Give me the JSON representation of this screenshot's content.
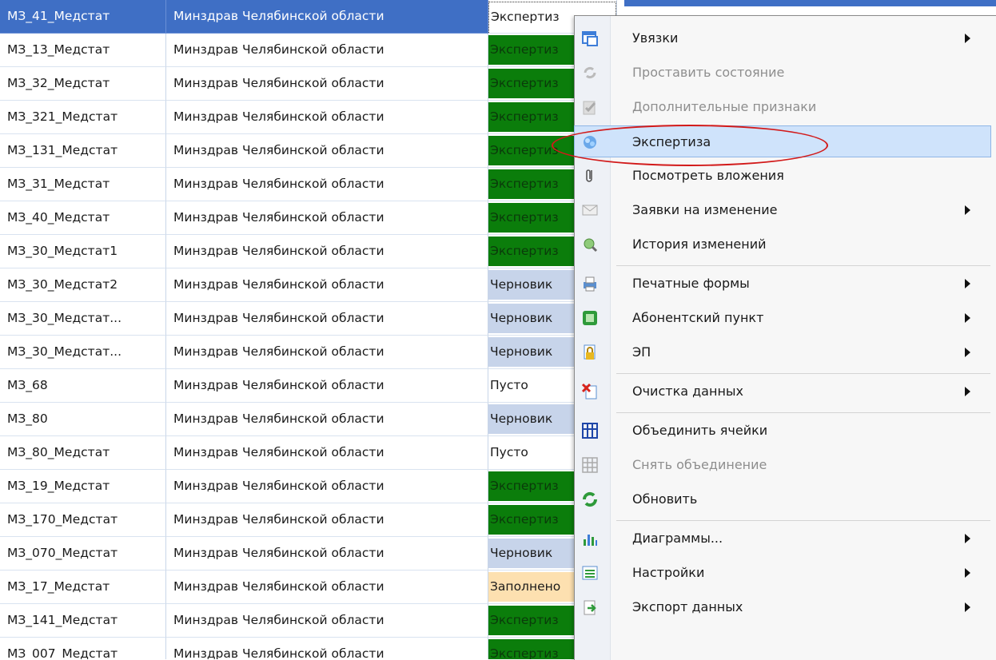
{
  "colors": {
    "selection": "#3f6fc5",
    "status_expertise": "#0b7d0b",
    "status_draft": "#c7d4ea",
    "status_filled": "#fde0b0",
    "menu_highlight": "#cfe3fb",
    "annotation_ring": "#d21a1a"
  },
  "table": {
    "rows": [
      {
        "code": "МЗ_41_Медстат",
        "org": "Минздрав Челябинской области",
        "status": "Экспертиз",
        "status_kind": "focus"
      },
      {
        "code": "МЗ_13_Медстат",
        "org": "Минздрав Челябинской области",
        "status": "Экспертиз",
        "status_kind": "expert"
      },
      {
        "code": "МЗ_32_Медстат",
        "org": "Минздрав Челябинской области",
        "status": "Экспертиз",
        "status_kind": "expert"
      },
      {
        "code": "МЗ_321_Медстат",
        "org": "Минздрав Челябинской области",
        "status": "Экспертиз",
        "status_kind": "expert"
      },
      {
        "code": "МЗ_131_Медстат",
        "org": "Минздрав Челябинской области",
        "status": "Экспертиз",
        "status_kind": "expert"
      },
      {
        "code": "МЗ_31_Медстат",
        "org": "Минздрав Челябинской области",
        "status": "Экспертиз",
        "status_kind": "expert"
      },
      {
        "code": "МЗ_40_Медстат",
        "org": "Минздрав Челябинской области",
        "status": "Экспертиз",
        "status_kind": "expert"
      },
      {
        "code": "МЗ_30_Медстат1",
        "org": "Минздрав Челябинской области",
        "status": "Экспертиз",
        "status_kind": "expert"
      },
      {
        "code": "МЗ_30_Медстат2",
        "org": "Минздрав Челябинской области",
        "status": "Черновик",
        "status_kind": "draft"
      },
      {
        "code": "МЗ_30_Медстат...",
        "org": "Минздрав Челябинской области",
        "status": "Черновик",
        "status_kind": "draft"
      },
      {
        "code": "МЗ_30_Медстат...",
        "org": "Минздрав Челябинской области",
        "status": "Черновик",
        "status_kind": "draft"
      },
      {
        "code": "МЗ_68",
        "org": "Минздрав Челябинской области",
        "status": "Пусто",
        "status_kind": "empty"
      },
      {
        "code": "МЗ_80",
        "org": "Минздрав Челябинской области",
        "status": "Черновик",
        "status_kind": "draft"
      },
      {
        "code": "МЗ_80_Медстат",
        "org": "Минздрав Челябинской области",
        "status": "Пусто",
        "status_kind": "empty"
      },
      {
        "code": "МЗ_19_Медстат",
        "org": "Минздрав Челябинской области",
        "status": "Экспертиз",
        "status_kind": "expert"
      },
      {
        "code": "МЗ_170_Медстат",
        "org": "Минздрав Челябинской области",
        "status": "Экспертиз",
        "status_kind": "expert"
      },
      {
        "code": "МЗ_070_Медстат",
        "org": "Минздрав Челябинской области",
        "status": "Черновик",
        "status_kind": "draft"
      },
      {
        "code": "МЗ_17_Медстат",
        "org": "Минздрав Челябинской области",
        "status": "Заполнено",
        "status_kind": "filled"
      },
      {
        "code": "МЗ_141_Медстат",
        "org": "Минздрав Челябинской области",
        "status": "Экспертиз",
        "status_kind": "expert"
      },
      {
        "code": "МЗ_007_Медстат",
        "org": "Минздрав Челябинской области",
        "status": "Экспертиз",
        "status_kind": "expert"
      }
    ]
  },
  "menu": {
    "items": [
      {
        "label": "Увязки",
        "icon": "links-window-icon",
        "submenu": true,
        "disabled": false,
        "highlighted": false,
        "sep_before": false
      },
      {
        "label": "Проставить состояние",
        "icon": "set-state-icon",
        "submenu": false,
        "disabled": true,
        "highlighted": false,
        "sep_before": false
      },
      {
        "label": "Дополнительные признаки",
        "icon": "additional-attributes-icon",
        "submenu": false,
        "disabled": true,
        "highlighted": false,
        "sep_before": false
      },
      {
        "label": "Экспертиза",
        "icon": "expertise-icon",
        "submenu": false,
        "disabled": false,
        "highlighted": true,
        "sep_before": false
      },
      {
        "label": "Посмотреть вложения",
        "icon": "paperclip-icon",
        "submenu": false,
        "disabled": false,
        "highlighted": false,
        "sep_before": false
      },
      {
        "label": "Заявки на изменение",
        "icon": "envelope-icon",
        "submenu": true,
        "disabled": false,
        "highlighted": false,
        "sep_before": false
      },
      {
        "label": "История изменений",
        "icon": "history-search-icon",
        "submenu": false,
        "disabled": false,
        "highlighted": false,
        "sep_before": false
      },
      {
        "label": "Печатные формы",
        "icon": "printer-icon",
        "submenu": true,
        "disabled": false,
        "highlighted": false,
        "sep_before": true
      },
      {
        "label": "Абонентский пункт",
        "icon": "subscriber-point-icon",
        "submenu": true,
        "disabled": false,
        "highlighted": false,
        "sep_before": false
      },
      {
        "label": "ЭП",
        "icon": "signature-lock-icon",
        "submenu": true,
        "disabled": false,
        "highlighted": false,
        "sep_before": false
      },
      {
        "label": "Очистка данных",
        "icon": "clear-data-icon",
        "submenu": true,
        "disabled": false,
        "highlighted": false,
        "sep_before": true
      },
      {
        "label": "Объединить ячейки",
        "icon": "merge-cells-icon",
        "submenu": false,
        "disabled": false,
        "highlighted": false,
        "sep_before": true
      },
      {
        "label": "Снять объединение",
        "icon": "unmerge-cells-icon",
        "submenu": false,
        "disabled": true,
        "highlighted": false,
        "sep_before": false
      },
      {
        "label": "Обновить",
        "icon": "refresh-icon",
        "submenu": false,
        "disabled": false,
        "highlighted": false,
        "sep_before": false
      },
      {
        "label": "Диаграммы...",
        "icon": "chart-icon",
        "submenu": true,
        "disabled": false,
        "highlighted": false,
        "sep_before": true
      },
      {
        "label": "Настройки",
        "icon": "settings-list-icon",
        "submenu": true,
        "disabled": false,
        "highlighted": false,
        "sep_before": false
      },
      {
        "label": "Экспорт данных",
        "icon": "export-data-icon",
        "submenu": true,
        "disabled": false,
        "highlighted": false,
        "sep_before": false
      }
    ]
  }
}
